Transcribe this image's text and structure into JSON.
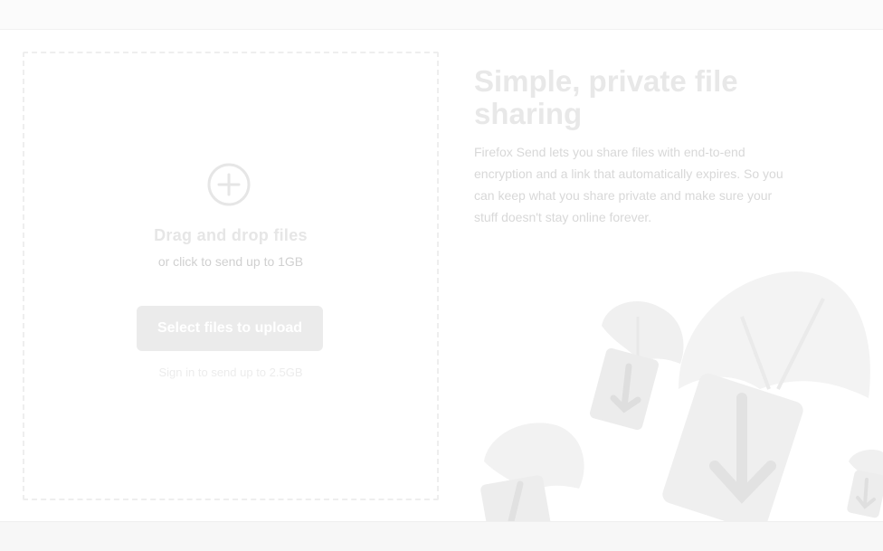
{
  "header": {},
  "upload": {
    "drop_title": "Drag and drop files",
    "drop_subtitle": "or click to send up to 1GB",
    "select_button": "Select files to upload",
    "signin_note": "Sign in to send up to 2.5GB"
  },
  "hero": {
    "title": "Simple, private file sharing",
    "description": "Firefox Send lets you share files with end-to-end encryption and a link that automatically expires. So you can keep what you share private and make sure your stuff doesn't stay online forever."
  },
  "icons": {
    "add": "plus-circle-icon",
    "illustration": "parachute-boxes-illustration"
  },
  "colors": {
    "background": "#ffffff",
    "button": "#ebebeb",
    "muted_text": "#d8d8d8"
  }
}
